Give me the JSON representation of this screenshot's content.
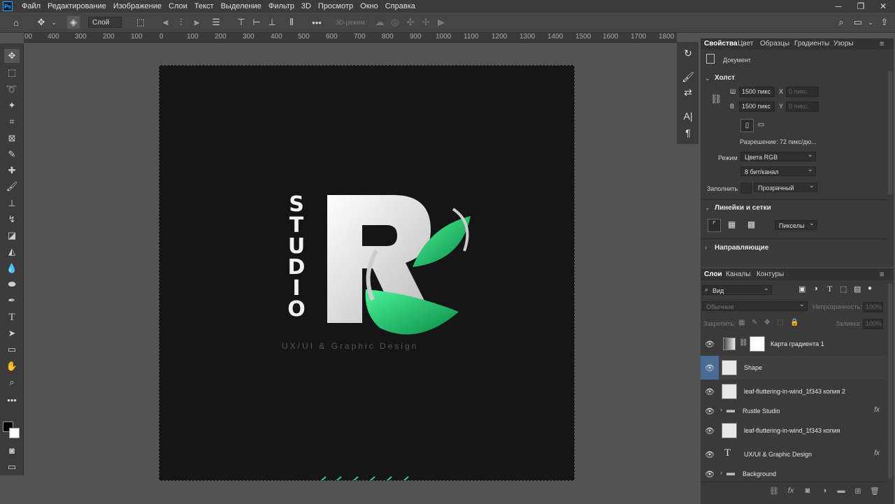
{
  "app": {
    "logo": "Ps"
  },
  "menu": [
    "Файл",
    "Редактирование",
    "Изображение",
    "Слои",
    "Текст",
    "Выделение",
    "Фильтр",
    "3D",
    "Просмотр",
    "Окно",
    "Справка"
  ],
  "options_bar": {
    "layer_select": "Слой",
    "mode_3d_label": "3D-режим:"
  },
  "ruler_top": [
    "00",
    "400",
    "300",
    "200",
    "100",
    "0",
    "100",
    "200",
    "300",
    "400",
    "500",
    "600",
    "700",
    "800",
    "900",
    "1000",
    "1100",
    "1200",
    "1300",
    "1400",
    "1500",
    "1600",
    "1700",
    "1800"
  ],
  "canvas": {
    "logo_letter": "R",
    "studio_text": "STUDIO",
    "tagline": "UX/UI & Graphic Design",
    "accent_color": "#2fd37a",
    "background_color": "#151515"
  },
  "properties": {
    "tabs": [
      "Свойства",
      "Цвет",
      "Образцы",
      "Градиенты",
      "Узоры"
    ],
    "doc_label": "Документ",
    "canvas_section": "Холст",
    "width_label": "Ш",
    "width_value": "1500 пикс",
    "height_label": "В",
    "height_value": "1500 пикс",
    "x_label": "X",
    "x_value": "0 пикс.",
    "y_label": "Y",
    "y_value": "0 пикс.",
    "resolution": "Разрешение: 72 пикс/дю...",
    "mode_label": "Режим",
    "mode_value": "Цвета RGB",
    "depth_value": "8 бит/канал",
    "fill_label": "Заполнить",
    "fill_value": "Прозрачный",
    "rulers_section": "Линейки и сетки",
    "units_value": "Пикселы",
    "guides_section": "Направляющие"
  },
  "layers_panel": {
    "tabs": [
      "Слои",
      "Каналы",
      "Контуры"
    ],
    "filter_value": "Вид",
    "blend_value": "Обычные",
    "opacity_label": "Непрозрачность:",
    "opacity_value": "100%",
    "lock_label": "Закрепить:",
    "fill_label": "Заливка:",
    "fill_value": "100%",
    "layers": [
      {
        "name": "Карта градиента 1"
      },
      {
        "name": "Shape"
      },
      {
        "name": "leaf-fluttering-in-wind_1f343 копия 2"
      },
      {
        "name": "Rustle Studio"
      },
      {
        "name": "leaf-fluttering-in-wind_1f343 копия"
      },
      {
        "name": "UX/UI & Graphic Design"
      },
      {
        "name": "Background"
      }
    ]
  }
}
